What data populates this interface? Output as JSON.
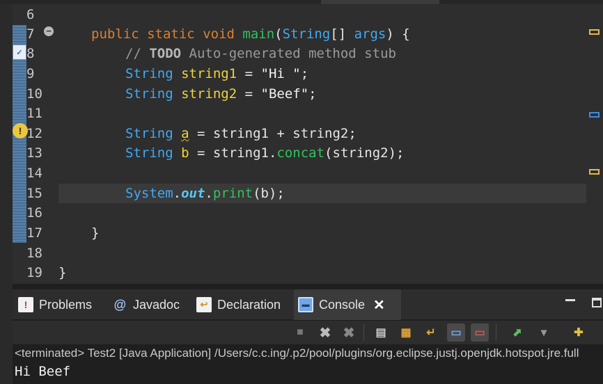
{
  "editor": {
    "line_numbers": [
      "6",
      "7",
      "8",
      "9",
      "10",
      "11",
      "12",
      "13",
      "14",
      "15",
      "16",
      "17",
      "18",
      "19"
    ],
    "code": {
      "l7": {
        "t1": "public",
        "t2": "static",
        "t3": "void",
        "t4": "main",
        "t5": "(",
        "t6": "String",
        "t7": "[] ",
        "t8": "args",
        "t9": ") {"
      },
      "l8": {
        "t1": "// ",
        "t2": "TODO",
        "t3": " Auto-generated method stub"
      },
      "l9": {
        "t1": "String",
        "t2": "string1",
        "t3": " = ",
        "t4": "\"Hi \"",
        "t5": ";"
      },
      "l10": {
        "t1": "String",
        "t2": "string2",
        "t3": " = ",
        "t4": "\"Beef\"",
        "t5": ";"
      },
      "l12": {
        "t1": "String",
        "t2": "a",
        "t3": " = ",
        "t4": "string1",
        "t5": " + ",
        "t6": "string2",
        "t7": ";"
      },
      "l13": {
        "t1": "String",
        "t2": "b",
        "t3": " = ",
        "t4": "string1",
        "t5": ".",
        "t6": "concat",
        "t7": "(",
        "t8": "string2",
        "t9": ");"
      },
      "l15": {
        "t1": "System",
        "t2": ".",
        "t3": "out",
        "t4": ".",
        "t5": "print",
        "t6": "(",
        "t7": "b",
        "t8": ");"
      },
      "l17": {
        "t1": "}"
      },
      "l19": {
        "t1": "}"
      }
    }
  },
  "panel": {
    "tabs": {
      "problems": "Problems",
      "javadoc": "Javadoc",
      "declaration": "Declaration",
      "console": "Console"
    },
    "status": "<terminated> Test2 [Java Application] /Users/c.c.ing/.p2/pool/plugins/org.eclipse.justj.openjdk.hotspot.jre.full",
    "output": "Hi Beef"
  },
  "colors": {
    "keyword": "#d98136",
    "method": "#33c15c",
    "type": "#3fa9f5",
    "variable": "#f0d43a",
    "comment": "#9a9a9a",
    "warning": "#e9c73f",
    "change_bar": "#4e7aa6"
  },
  "icons": {
    "problems": "problems-icon",
    "javadoc": "javadoc-icon",
    "declaration": "declaration-icon",
    "console": "console-icon",
    "warning": "warning-icon",
    "task": "task-icon"
  }
}
